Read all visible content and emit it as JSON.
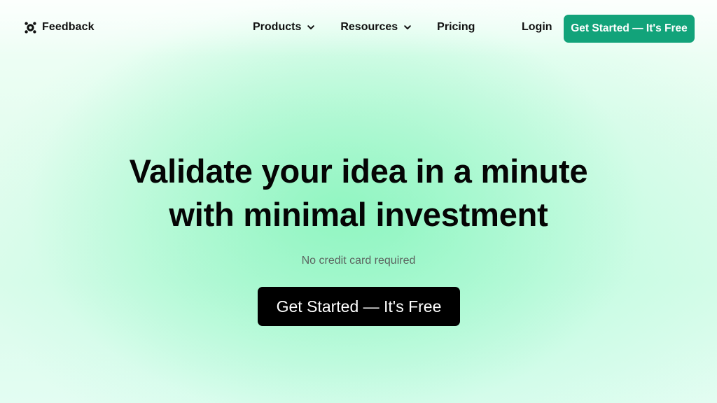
{
  "brand": {
    "name": "Feedback",
    "icon": "feedback-logo-icon"
  },
  "nav": {
    "items": [
      {
        "label": "Products",
        "icon": "chevron-down-icon"
      },
      {
        "label": "Resources",
        "icon": "chevron-down-icon"
      },
      {
        "label": "Pricing"
      }
    ],
    "login_label": "Login",
    "cta_label": "Get Started — It's Free"
  },
  "hero": {
    "title_line1": "Validate your idea in a minute",
    "title_line2": "with minimal investment",
    "subtitle": "No credit card required",
    "cta_label": "Get Started — It's Free"
  },
  "colors": {
    "accent": "#12a37a",
    "primary_button": "#000000",
    "background_glow": "#8ff5c4"
  }
}
